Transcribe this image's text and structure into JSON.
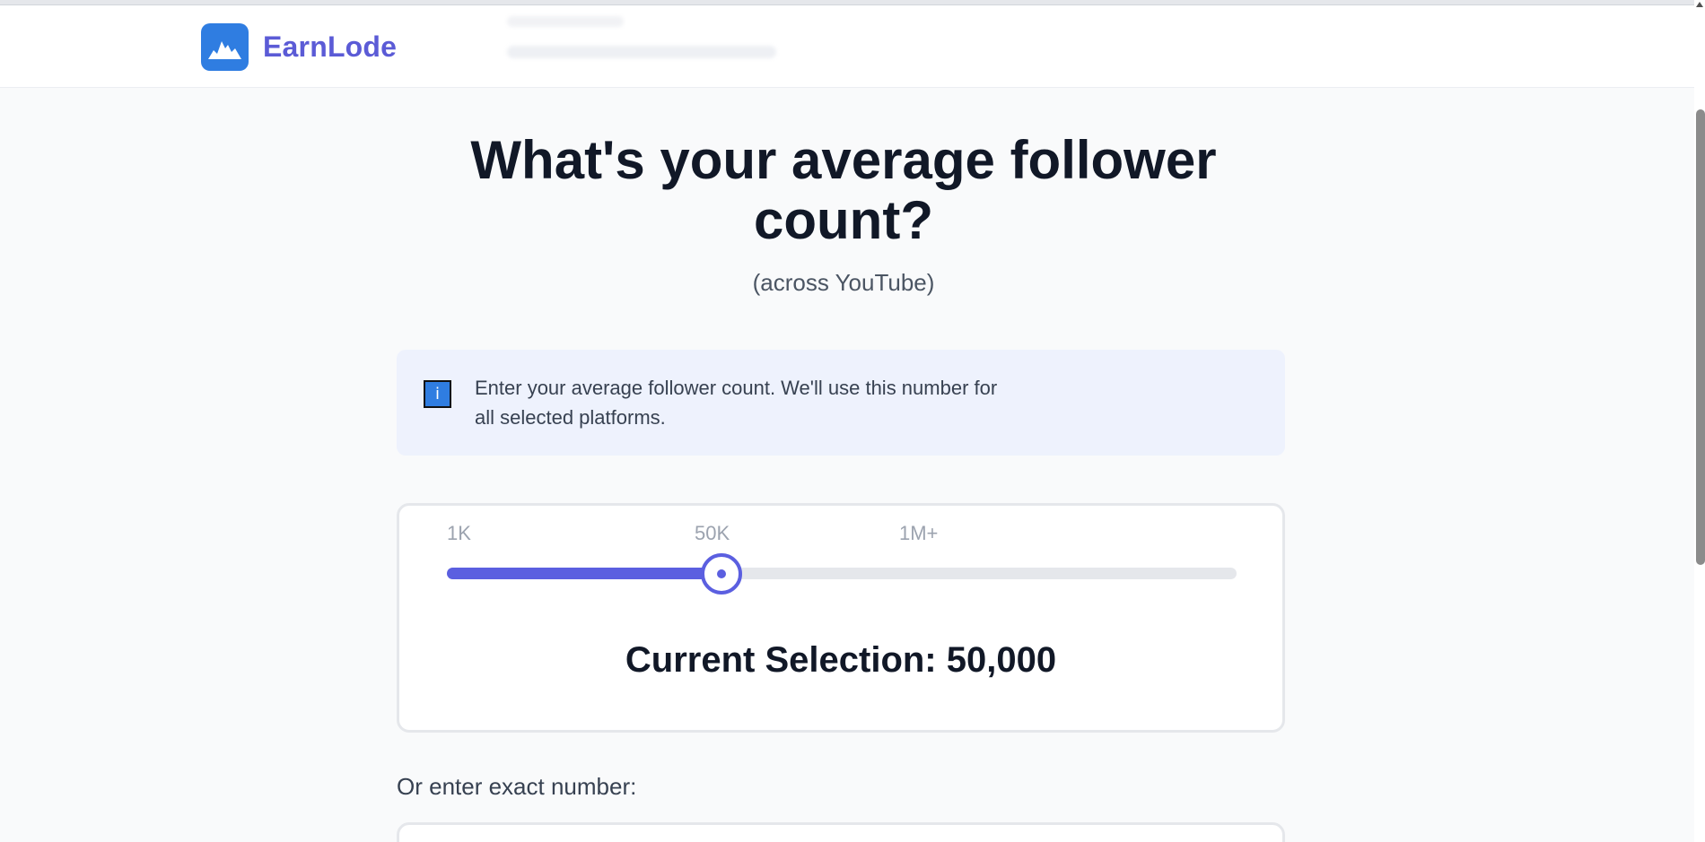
{
  "header": {
    "brand": "EarnLode",
    "logo_icon": "mountain-chart-icon"
  },
  "main": {
    "title": "What's your average follower count?",
    "subtitle": "(across YouTube)"
  },
  "info": {
    "icon": "info-icon",
    "icon_glyph": "i",
    "text": "Enter your average follower count. We'll use this number for all selected platforms."
  },
  "slider": {
    "tick_labels": [
      "1K",
      "50K",
      "1M+"
    ],
    "selection_label": "Current Selection: 50,000",
    "value": 50000,
    "fill_fraction": 0.348
  },
  "exact": {
    "label": "Or enter exact number:",
    "value": ""
  },
  "colors": {
    "brand": "#5b5bd6",
    "logo_bg": "#2f7de1",
    "accent": "#5b5fe0",
    "info_bg": "#eef2fd"
  }
}
